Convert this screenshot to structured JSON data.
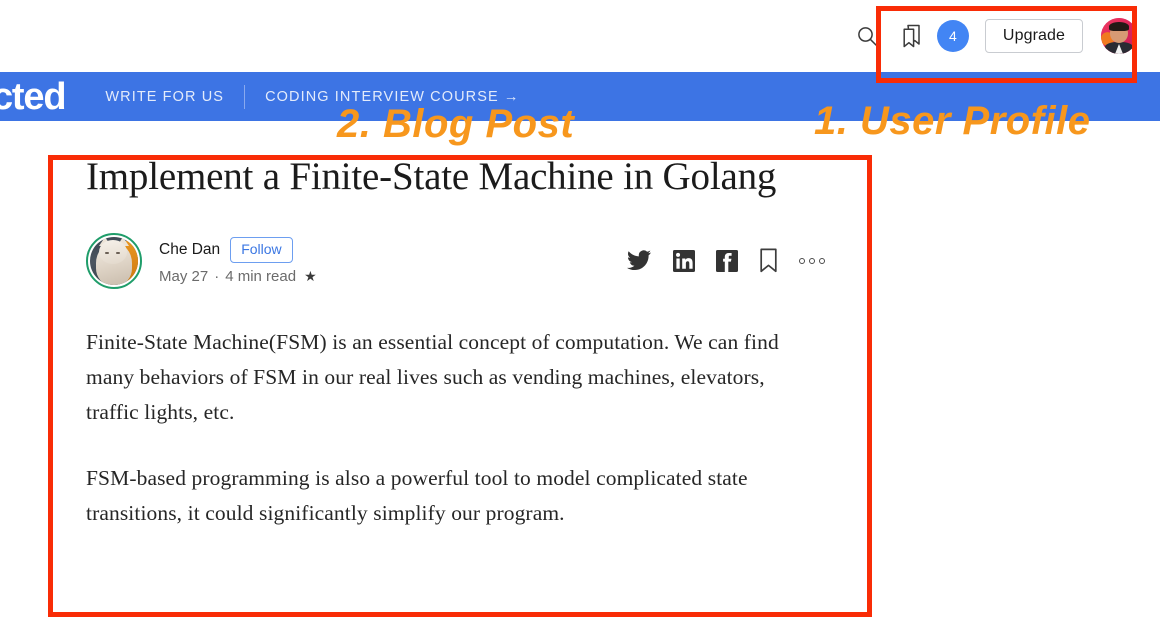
{
  "header": {
    "search_icon": "search-icon",
    "bookmark_icon": "bookmark-icon",
    "notification_count": "4",
    "upgrade_label": "Upgrade",
    "avatar_alt": "user-profile-photo"
  },
  "nav": {
    "brand": "cted",
    "links": [
      {
        "label": "WRITE FOR US"
      },
      {
        "label": "CODING INTERVIEW COURSE →"
      }
    ]
  },
  "article": {
    "title": "Implement a Finite-State Machine in Golang",
    "author": {
      "name": "Che Dan",
      "follow_label": "Follow",
      "avatar_alt": "author-avatar-cat-photo"
    },
    "meta": {
      "date": "May 27",
      "separator": "·",
      "read_time": "4 min read",
      "star": "★"
    },
    "share": {
      "twitter": "twitter-icon",
      "linkedin": "linkedin-icon",
      "facebook": "facebook-icon",
      "bookmark": "bookmark-icon",
      "more": "more-options-icon"
    },
    "paragraphs": [
      "Finite-State Machine(FSM) is an essential concept of computation. We can find many behaviors of FSM in our real lives such as vending machines, elevators, traffic lights, etc.",
      "FSM-based programming is also a powerful tool to model complicated state transitions, it could significantly simplify our program."
    ]
  },
  "annotations": [
    {
      "id": "user-profile",
      "label": "1. User Profile"
    },
    {
      "id": "blog-post",
      "label": "2. Blog Post"
    }
  ],
  "colors": {
    "nav_blue": "#3d74e4",
    "annotation_red": "#f92c06",
    "annotation_orange": "#f7971d",
    "badge_blue": "#4285f4",
    "follow_blue": "#3b77e3",
    "avatar_ring_green": "#1f9d6a"
  }
}
